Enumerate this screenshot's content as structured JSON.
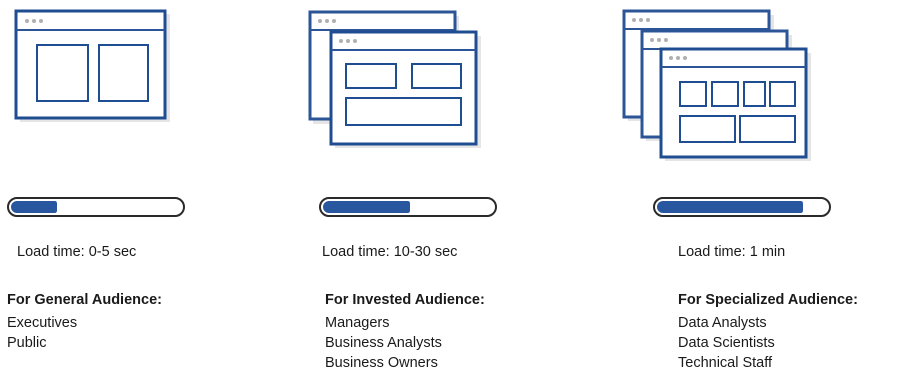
{
  "tiers": [
    {
      "load_time": "Load time: 0-5 sec",
      "load_fraction": 0.27,
      "audience_title": "For General Audience:",
      "audience": [
        "Executives",
        "Public"
      ],
      "window_icon": "dashboard-window-icon"
    },
    {
      "load_time": "Load time: 10-30 sec",
      "load_fraction": 0.51,
      "audience_title": "For Invested Audience:",
      "audience": [
        "Managers",
        "Business Analysts",
        "Business Owners"
      ],
      "window_icon": "stacked-dashboard-windows-icon"
    },
    {
      "load_time": "Load time: 1 min",
      "load_fraction": 0.86,
      "audience_title": "For Specialized Audience:",
      "audience": [
        "Data Analysts",
        "Data Scientists",
        "Technical Staff"
      ],
      "window_icon": "triple-stacked-dashboard-windows-icon"
    }
  ],
  "colors": {
    "accent": "#2857a0",
    "outline": "#1f4d91",
    "text": "#1a1a1a"
  }
}
